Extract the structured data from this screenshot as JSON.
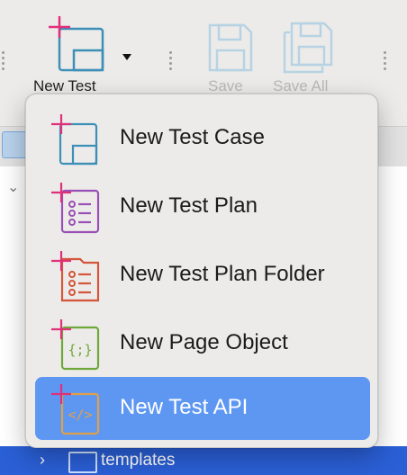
{
  "toolbar": {
    "new_test_label": "New Test",
    "save_label": "Save",
    "save_all_label": "Save All"
  },
  "menu": {
    "items": [
      {
        "label": "New Test Case",
        "icon": "test-case-icon",
        "color": "#3d8fb8"
      },
      {
        "label": "New Test Plan",
        "icon": "test-plan-icon",
        "color": "#9a4fb6"
      },
      {
        "label": "New Test Plan Folder",
        "icon": "test-plan-folder-icon",
        "color": "#d4553a"
      },
      {
        "label": "New Page Object",
        "icon": "page-object-icon",
        "color": "#6fa83a"
      },
      {
        "label": "New Test API",
        "icon": "test-api-icon",
        "color": "#e0a04a"
      }
    ],
    "active_index": 4,
    "plus_color": "#e0307a",
    "highlight_color": "#5e97f2"
  },
  "tree": {
    "selected_label": "templates"
  }
}
